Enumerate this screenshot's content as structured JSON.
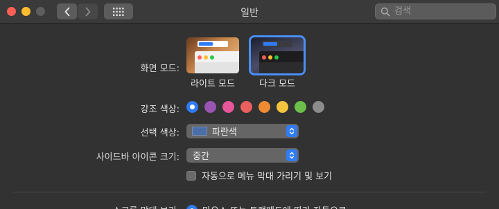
{
  "window": {
    "title": "일반"
  },
  "search": {
    "placeholder": "검색"
  },
  "appearance": {
    "label": "화면 모드:",
    "light_caption": "라이트 모드",
    "dark_caption": "다크 모드",
    "selected": "dark"
  },
  "accent": {
    "label": "강조 색상:",
    "colors": [
      "#2f7cf6",
      "#9a55b3",
      "#e6569a",
      "#ec5f5f",
      "#ef8a33",
      "#f4c43e",
      "#6cbf4a",
      "#8c8c8c"
    ],
    "selected_index": 0
  },
  "highlight": {
    "label": "선택 색상:",
    "value": "파란색",
    "swatch_color": "#4a6fa8"
  },
  "sidebar_icon": {
    "label": "사이드바 아이콘 크기:",
    "value": "중간"
  },
  "menubar": {
    "label": "자동으로 메뉴 막대 가리기 및 보기",
    "checked": false
  },
  "scrollbars": {
    "label": "스크롤 막대 보기:",
    "option": "마우스 또는 트랙패드에 따라 자동으로"
  }
}
